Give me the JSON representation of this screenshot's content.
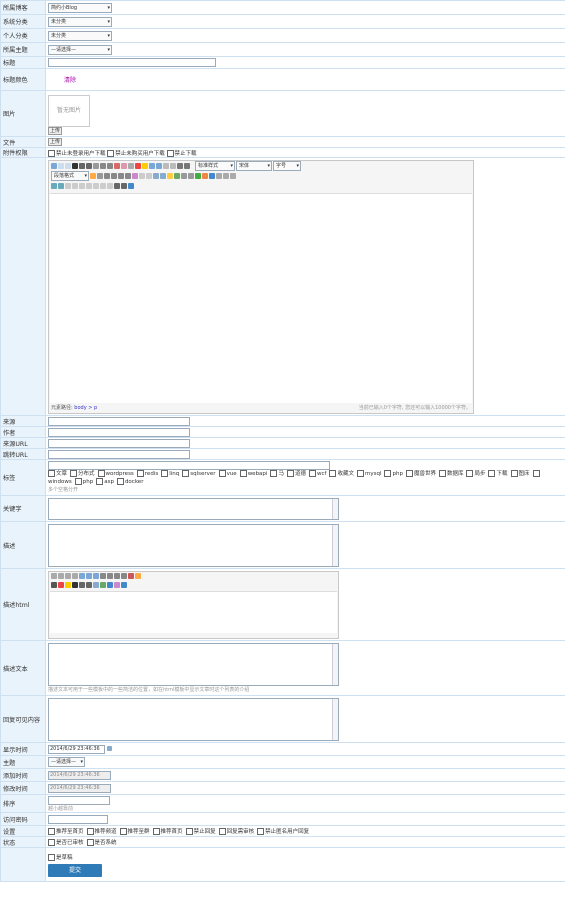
{
  "colors": {
    "label_bg": "#e9f3fb",
    "border": "#cfe0f0",
    "submit_bg": "#2f7bb8",
    "required": "#cc0000",
    "clear": "#aa00aa"
  },
  "rows": {
    "blog": {
      "label": "所属博客",
      "value": "简约小Blog"
    },
    "sys_cat": {
      "label": "系统分类",
      "value": "未分类"
    },
    "user_cat": {
      "label": "个人分类",
      "value": "未分类"
    },
    "topic": {
      "label": "所属主题",
      "value": "—请选择—"
    },
    "title": {
      "label": "标题"
    },
    "title_color": {
      "label": "标题颜色",
      "clear": "清除"
    },
    "image": {
      "label": "图片",
      "placeholder": "暂无图片",
      "upload": "上传"
    },
    "file": {
      "label": "文件",
      "upload": "上传"
    },
    "attach_perm": {
      "label": "附件权限",
      "options": [
        "禁止未登录用户下载",
        "禁止未购买用户下载",
        "禁止下载"
      ]
    },
    "editor": {
      "font": "宋体",
      "size": "字号",
      "style": "标准样式",
      "para": "段落格式",
      "path_label": "元素路径:",
      "path": "body > p",
      "count": "当前已输入0个字符, 您还可以输入10000个字符。"
    },
    "source": {
      "label": "来源"
    },
    "author": {
      "label": "作者"
    },
    "source_url": {
      "label": "来源URL"
    },
    "jump_url": {
      "label": "跳转URL"
    },
    "tags": {
      "label": "标签",
      "items": [
        "文章",
        "分布式",
        "wordpress",
        "redis",
        "linq",
        "sqlserver",
        "vue",
        "webapi",
        "马",
        "道德",
        "wcf",
        "收藏文",
        "mysql",
        "php",
        "魔兽世界",
        "数据库",
        "局步",
        "下载",
        "图床",
        "windows",
        "php",
        "asp",
        "docker"
      ],
      "hint": "多个空格分开"
    },
    "keywords": {
      "label": "关键字"
    },
    "desc": {
      "label": "描述"
    },
    "desc_html": {
      "label": "描述html"
    },
    "desc_text": {
      "label": "描述文本",
      "hint": "描述文本可用于一些模板中的一些简洁的位置，如在html模板中显示文章时这个列表的介绍"
    },
    "reply_content": {
      "label": "回复可见内容"
    },
    "show_time": {
      "label": "显示时间",
      "value": "2014/6/29 23:46:36"
    },
    "theme": {
      "label": "主题",
      "value": "—请选择—"
    },
    "add_time": {
      "label": "添加时间",
      "value": "2014/6/29 23:46:36"
    },
    "mod_time": {
      "label": "修改时间",
      "value": "2014/6/29 23:46:36"
    },
    "order": {
      "label": "排序",
      "hint": "越小越靠前"
    },
    "password": {
      "label": "访问密码"
    },
    "settings": {
      "label": "设置",
      "options": [
        "推荐至首页",
        "推荐频道",
        "推荐至群",
        "推荐首页",
        "禁止回复",
        "回复需审核",
        "禁止匿名用户回复"
      ]
    },
    "status": {
      "label": "状态",
      "options": [
        "是否已审核",
        "是否系统"
      ]
    },
    "draft": {
      "option": "是草稿"
    }
  },
  "submit_label": "提交"
}
